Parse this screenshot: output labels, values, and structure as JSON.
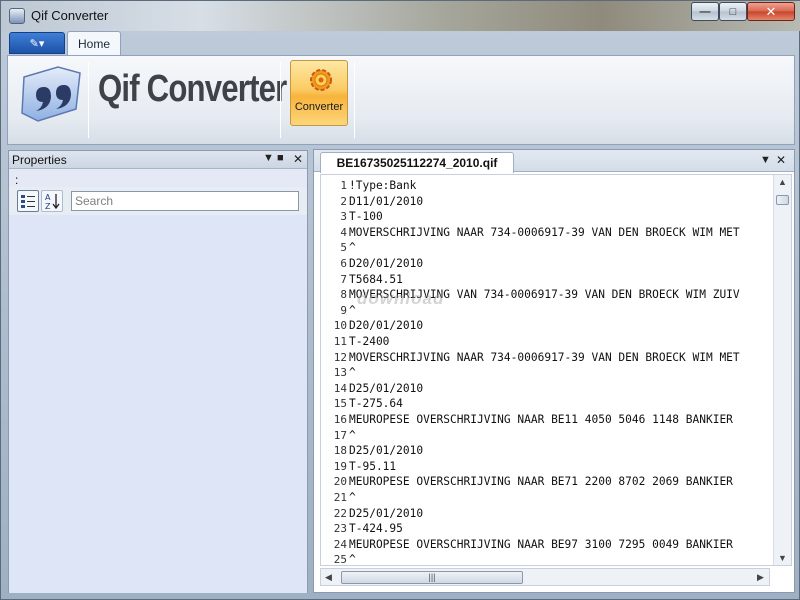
{
  "window": {
    "title": "Qif Converter",
    "min_icon": "minimize-icon",
    "max_icon": "maximize-icon",
    "close_icon": "close-icon"
  },
  "ribbon": {
    "app_menu_icon": "pencil-icon",
    "tabs": [
      {
        "label": "Home"
      }
    ],
    "logo_text": "Qif Converter",
    "converter_button": {
      "label": "Converter",
      "icon": "gear-star-icon"
    }
  },
  "properties": {
    "title": "Properties",
    "prefix": ":",
    "search_placeholder": "Search",
    "search_value": "",
    "buttons": [
      "categorized-icon",
      "sort-alpha-icon"
    ]
  },
  "document": {
    "tab_label": "BE16735025112274_2010.qif",
    "lines": [
      {
        "n": "1",
        "text": "!Type:Bank"
      },
      {
        "n": "2",
        "text": "D11/01/2010"
      },
      {
        "n": "3",
        "text": "T-100"
      },
      {
        "n": "4",
        "text": "MOVERSCHRIJVING NAAR 734-0006917-39 VAN DEN BROECK WIM MET"
      },
      {
        "n": "5",
        "text": "^"
      },
      {
        "n": "6",
        "text": "D20/01/2010"
      },
      {
        "n": "7",
        "text": "T5684.51"
      },
      {
        "n": "8",
        "text": "MOVERSCHRIJVING VAN 734-0006917-39 VAN DEN BROECK WIM ZUIV"
      },
      {
        "n": "9",
        "text": "^"
      },
      {
        "n": "10",
        "text": "D20/01/2010"
      },
      {
        "n": "11",
        "text": "T-2400"
      },
      {
        "n": "12",
        "text": "MOVERSCHRIJVING NAAR 734-0006917-39 VAN DEN BROECK WIM MET"
      },
      {
        "n": "13",
        "text": "^"
      },
      {
        "n": "14",
        "text": "D25/01/2010"
      },
      {
        "n": "15",
        "text": "T-275.64"
      },
      {
        "n": "16",
        "text": "MEUROPESE OVERSCHRIJVING NAAR BE11 4050 5046 1148 BANKIER"
      },
      {
        "n": "17",
        "text": "^"
      },
      {
        "n": "18",
        "text": "D25/01/2010"
      },
      {
        "n": "19",
        "text": "T-95.11"
      },
      {
        "n": "20",
        "text": "MEUROPESE OVERSCHRIJVING NAAR BE71 2200 8702 2069 BANKIER"
      },
      {
        "n": "21",
        "text": "^"
      },
      {
        "n": "22",
        "text": "D25/01/2010"
      },
      {
        "n": "23",
        "text": "T-424.95"
      },
      {
        "n": "24",
        "text": "MEUROPESE OVERSCHRIJVING NAAR BE97 3100 7295 0049 BANKIER"
      },
      {
        "n": "25",
        "text": "^"
      }
    ]
  },
  "watermark": "download"
}
